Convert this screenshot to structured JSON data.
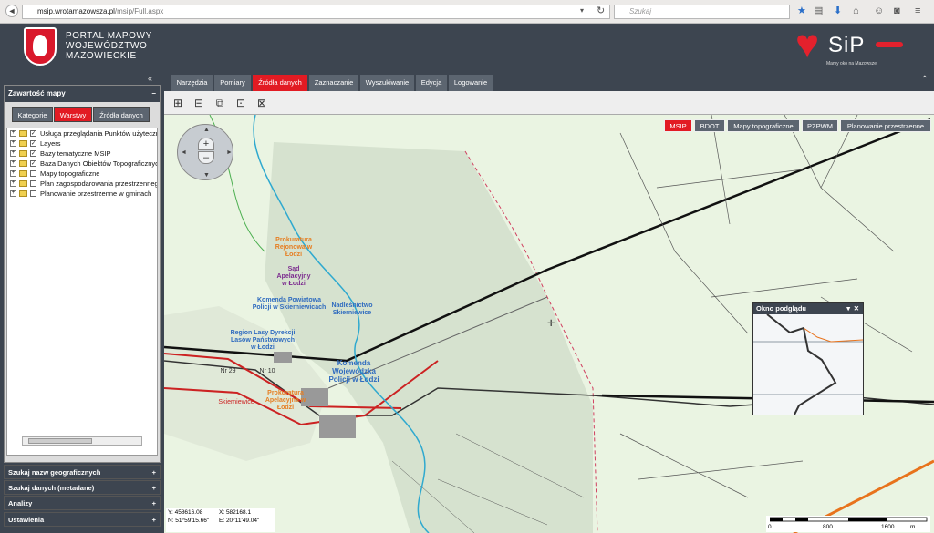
{
  "browser": {
    "url_host": "msip.wrotamazowsza.pl",
    "url_path": "/msip/Full.aspx",
    "search_placeholder": "Szukaj"
  },
  "header": {
    "title_lines": [
      "PORTAL MAPOWY",
      "WOJEWÓDZTWO",
      "MAZOWIECKIE"
    ],
    "logo_text": "SiP",
    "logo_tagline": "Mamy oko na Mazowsze"
  },
  "main_tabs": [
    "Narzędzia",
    "Pomiary",
    "Źródła danych",
    "Zaznaczanie",
    "Wyszukiwanie",
    "Edycja",
    "Logowanie"
  ],
  "active_main_tab": "Źródła danych",
  "layer_buttons": [
    "MSIP",
    "BDOT",
    "Mapy topograficzne",
    "PZPWM",
    "Planowanie przestrzenne"
  ],
  "active_layer_button": "MSIP",
  "left_panel": {
    "title": "Zawartość mapy",
    "tabs": [
      "Kategorie",
      "Warstwy",
      "Źródła danych"
    ],
    "active_tab": "Warstwy",
    "tree": [
      {
        "label": "Usługa przeglądania Punktów użyteczności",
        "checked": true
      },
      {
        "label": "Layers",
        "checked": true
      },
      {
        "label": "Bazy tematyczne MSIP",
        "checked": true
      },
      {
        "label": "Baza Danych Obiektów Topograficznych",
        "checked": true
      },
      {
        "label": "Mapy topograficzne",
        "checked": false
      },
      {
        "label": "Plan zagospodarowania przestrzennego",
        "checked": false
      },
      {
        "label": "Planowanie przestrzenne w gminach",
        "checked": false
      }
    ],
    "accordions": [
      "Szukaj nazw geograficznych",
      "Szukaj danych (metadane)",
      "Analizy",
      "Ustawienia"
    ]
  },
  "preview_window": {
    "title": "Okno podglądu"
  },
  "coords": {
    "y": "Y: 458616.08",
    "x": "X: 582168.1",
    "n": "N: 51°59'15.66\"",
    "e": "E: 20°11'49.04\""
  },
  "scale": {
    "labels": [
      "0",
      "800",
      "1600"
    ],
    "unit": "m"
  },
  "map_labels": [
    "Prokuratura Rejonowa w Łodzi",
    "Sąd Apelacyjny w Łodzi",
    "Komenda Powiatowa Policji w Skierniewicach",
    "Nadleśnictwo Skierniewice",
    "Region Lasy Dyrekcji Lasów Państwowych w Łodzi",
    "Komenda Wojewódzka Policji w Łodzi",
    "Prokuratura Apelacyjna w Łodzi",
    "Skierniewice",
    "Nr 29",
    "Nr 10"
  ],
  "colors": {
    "accent": "#e21b23",
    "header": "#3d4550",
    "tab": "#5c6570"
  }
}
